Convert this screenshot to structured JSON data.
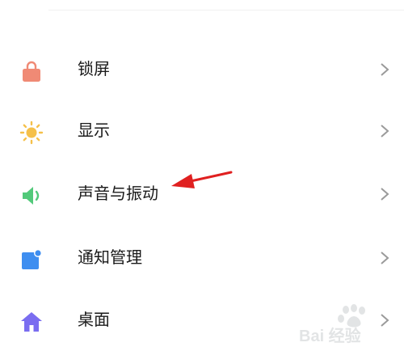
{
  "settings": {
    "items": [
      {
        "label": "锁屏",
        "icon": "lock-icon",
        "color": "#f08a75"
      },
      {
        "label": "显示",
        "icon": "sun-icon",
        "color": "#f5c04a"
      },
      {
        "label": "声音与振动",
        "icon": "speaker-icon",
        "color": "#52c97a"
      },
      {
        "label": "通知管理",
        "icon": "notification-icon",
        "color": "#3e8ef0"
      },
      {
        "label": "桌面",
        "icon": "home-icon",
        "color": "#7a6df0"
      }
    ]
  },
  "annotation": {
    "color": "#e02020"
  },
  "watermark": {
    "text": "Bai 经验"
  }
}
